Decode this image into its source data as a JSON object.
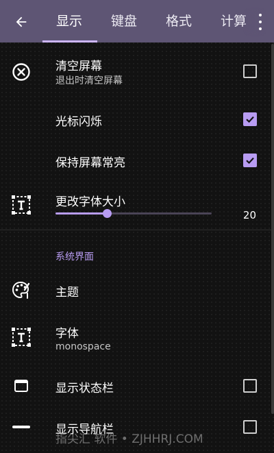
{
  "appbar": {
    "back_icon": "arrow-left-icon",
    "tabs": [
      {
        "label": "显示",
        "active": true
      },
      {
        "label": "键盘",
        "active": false
      },
      {
        "label": "格式",
        "active": false
      },
      {
        "label": "计算",
        "active": false
      }
    ],
    "overflow_icon": "more-vert-icon"
  },
  "settings": {
    "clear_screen": {
      "title": "清空屏幕",
      "subtitle": "退出时清空屏幕",
      "icon": "clear-circle-icon",
      "checked": false
    },
    "cursor_blink": {
      "title": "光标闪烁",
      "checked": true
    },
    "keep_screen_on": {
      "title": "保持屏幕常亮",
      "checked": true
    },
    "font_size": {
      "title": "更改字体大小",
      "icon": "text-fields-icon",
      "value": "20",
      "fraction": 0.33
    }
  },
  "system_ui": {
    "header": "系统界面",
    "theme": {
      "title": "主题",
      "icon": "palette-icon"
    },
    "font": {
      "title": "字体",
      "subtitle": "monospace",
      "icon": "text-fields-icon"
    },
    "status_bar": {
      "title": "显示状态栏",
      "icon": "window-icon",
      "checked": false
    },
    "nav_bar": {
      "title": "显示导航栏",
      "icon": "minus-bar-icon",
      "checked": false
    }
  },
  "watermark": "指尖汇 软件 • ZJHHRJ.COM",
  "colors": {
    "appbar": "#5e5574",
    "accent": "#b89cf2",
    "background": "#121212"
  }
}
